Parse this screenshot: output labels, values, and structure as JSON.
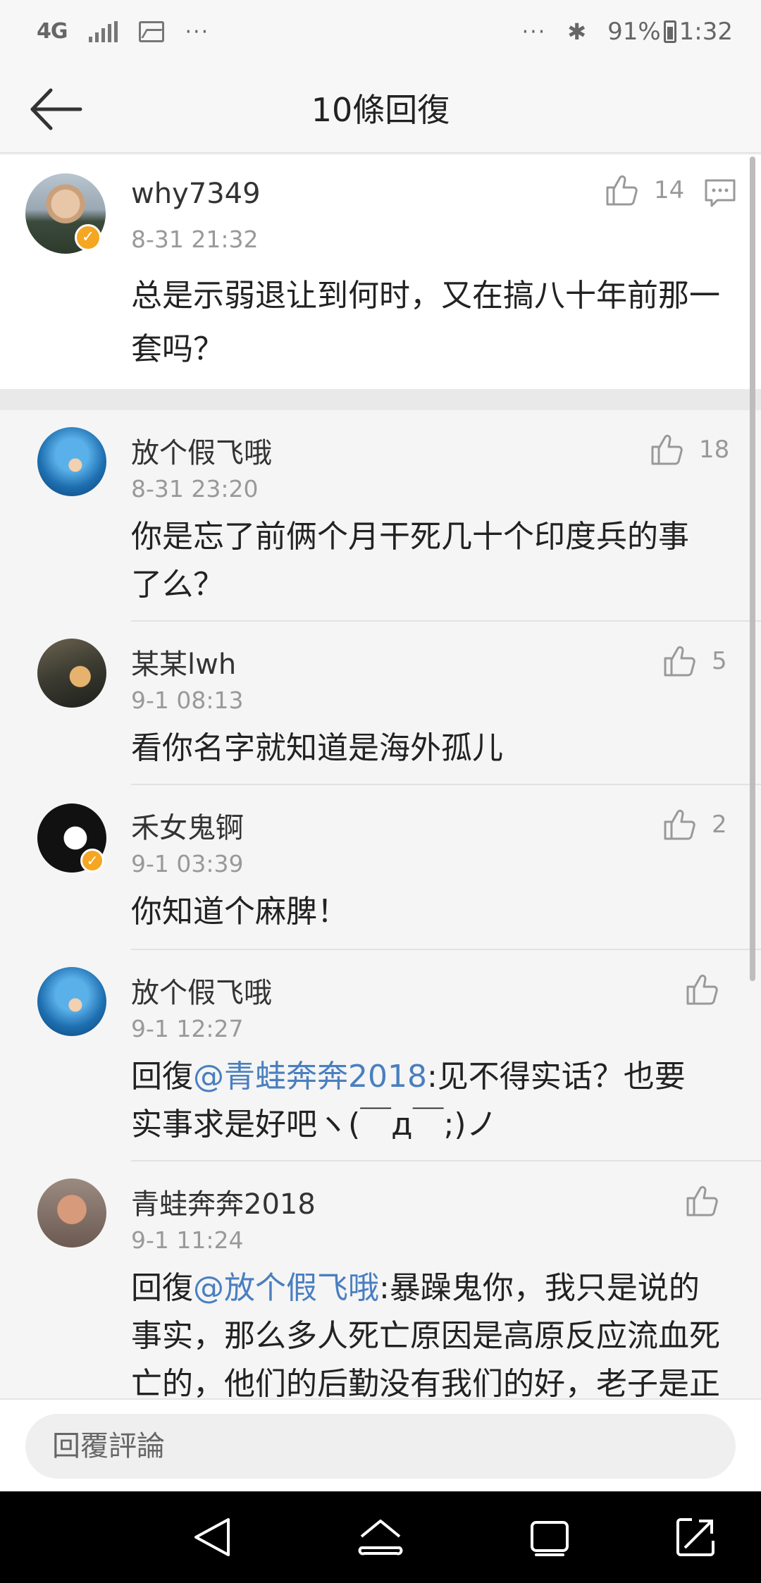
{
  "status_bar": {
    "network": "4G",
    "overflow": "···",
    "right_overflow": "···",
    "battery": "91%",
    "time": "1:32"
  },
  "header": {
    "title": "10條回復"
  },
  "main_post": {
    "username": "why7349",
    "time": "8-31 21:32",
    "content": "总是示弱退让到何时，又在搞八十年前那一套吗？",
    "likes": "14",
    "verified": true
  },
  "replies": [
    {
      "username": "放个假飞哦",
      "time": "8-31 23:20",
      "content": "你是忘了前俩个月干死几十个印度兵的事了么？",
      "likes": "18",
      "verified": false
    },
    {
      "username": "某某lwh",
      "time": "9-1 08:13",
      "content": "看你名字就知道是海外孤儿",
      "likes": "5",
      "verified": false
    },
    {
      "username": "禾女鬼锕",
      "time": "9-1 03:39",
      "content": "你知道个麻脾！",
      "likes": "2",
      "verified": true
    },
    {
      "username": "放个假飞哦",
      "time": "9-1 12:27",
      "reply_prefix": "回復",
      "mention": "@青蛙奔奔2018",
      "content": ":见不得实话？也要实事求是好吧ヽ(￣д￣;)ノ",
      "likes": "",
      "verified": false
    },
    {
      "username": "青蛙奔奔2018",
      "time": "9-1 11:24",
      "reply_prefix": "回復",
      "mention": "@放个假飞哦",
      "content": ":暴躁鬼你，我只是说的事实，那么多人死亡原因是高原反应流血死亡的，他们的后勤没有我们的好，老子是正宗的",
      "likes": "",
      "verified": false
    }
  ],
  "reply_bar": {
    "placeholder": "回覆評論"
  },
  "colors": {
    "mention": "#4a7fc0",
    "verified": "#f5a623",
    "muted": "#999999"
  },
  "icons": [
    "back-arrow-icon",
    "thumbs-up-icon",
    "comment-icon",
    "nav-back-icon",
    "nav-home-icon",
    "nav-recents-icon",
    "nav-expand-icon"
  ]
}
